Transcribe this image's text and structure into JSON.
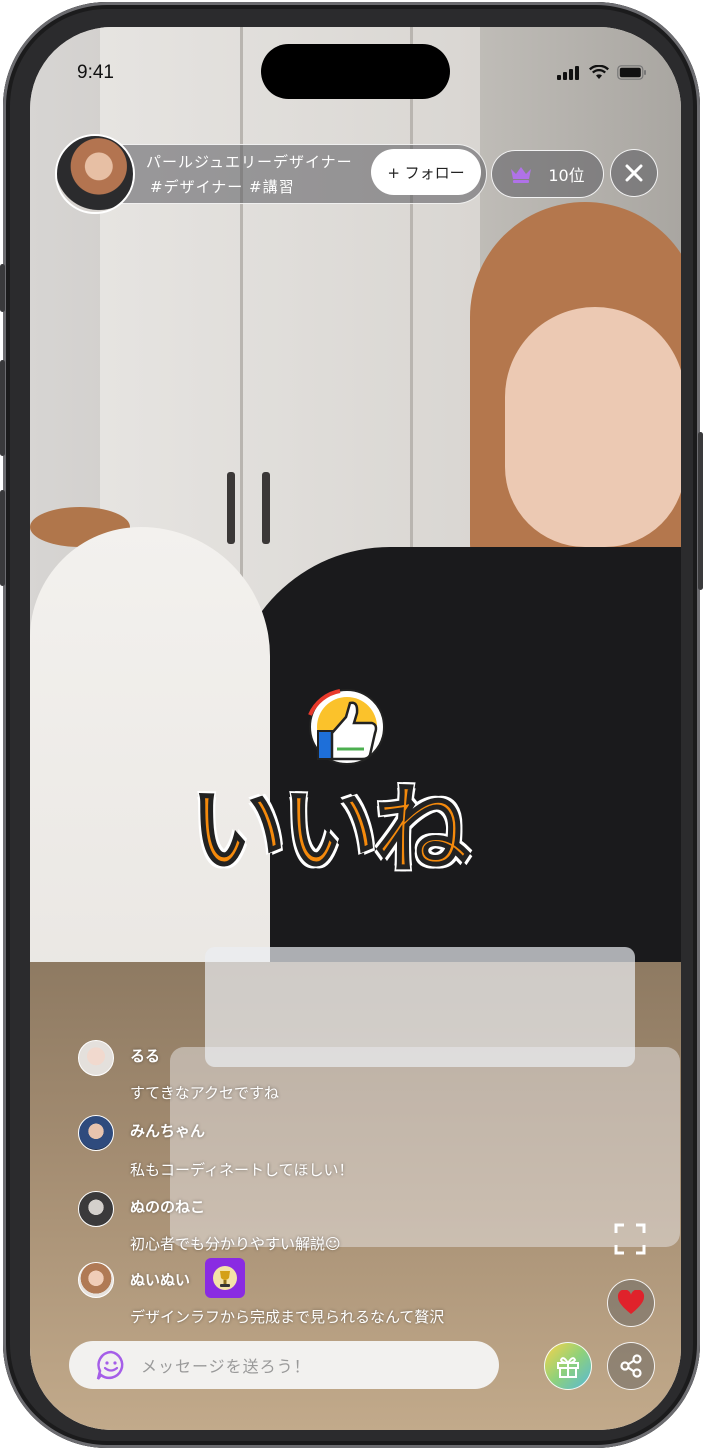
{
  "status_bar": {
    "time": "9:41"
  },
  "host": {
    "name": "パールジュエリーデザイナー",
    "tags": "#デザイナー #講習",
    "follow_label": "+ フォロー",
    "rank_label": "10位"
  },
  "reaction": {
    "text": "いいね"
  },
  "comments": [
    {
      "user": "るる",
      "message": "すてきなアクセですね"
    },
    {
      "user": "みんちゃん",
      "message": "私もコーディネートしてほしい！"
    },
    {
      "user": "ぬののねこ",
      "message": "初心者でも分かりやすい解説☺"
    },
    {
      "user": "ぬいぬい",
      "message": "デザインラフから完成まで見られるなんて贅沢"
    }
  ],
  "message_input": {
    "placeholder": "メッセージを送ろう！"
  },
  "colors": {
    "accent": "#8a2be2",
    "heart": "#e0222b",
    "reaction_orange": "#f58a0c"
  }
}
